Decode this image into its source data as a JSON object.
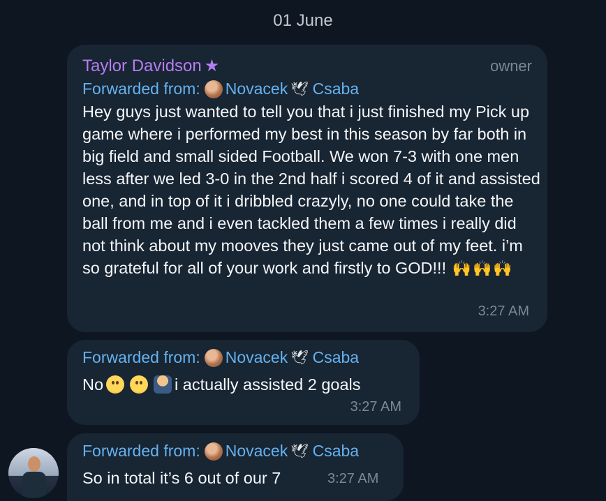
{
  "date": "01 June",
  "messages": [
    {
      "sender": "Taylor Davidson",
      "role": "owner",
      "forwarded_label": "Forwarded from:",
      "forwarded_name_1": "Novacek",
      "forwarded_name_2": "Csaba",
      "text": "Hey guys just wanted to tell you that i just finished my Pick up game where i performed my best in this season by far both in big field and small sided Football. We won 7-3 with one men less after we led 3-0 in the 2nd half i scored 4 of it and assisted one, and in top of it i dribbled crazyly, no one could take the ball from me and i even tackled them a few times i really did not think about my mooves they just came out of my feet. i’m so grateful for all of your work and firstly to GOD!!!",
      "time": "3:27 AM"
    },
    {
      "forwarded_label": "Forwarded from:",
      "forwarded_name_1": "Novacek",
      "forwarded_name_2": "Csaba",
      "text_prefix": "No",
      "text_suffix": "i actually assisted 2 goals",
      "time": "3:27 AM"
    },
    {
      "forwarded_label": "Forwarded from:",
      "forwarded_name_1": "Novacek",
      "forwarded_name_2": "Csaba",
      "text": "So in total it’s 6 out of our 7",
      "time": "3:27 AM"
    }
  ],
  "colors": {
    "background": "#0e1621",
    "bubble": "#182533",
    "sender": "#b57df2",
    "link": "#65b2f0",
    "meta": "#7c8793"
  }
}
